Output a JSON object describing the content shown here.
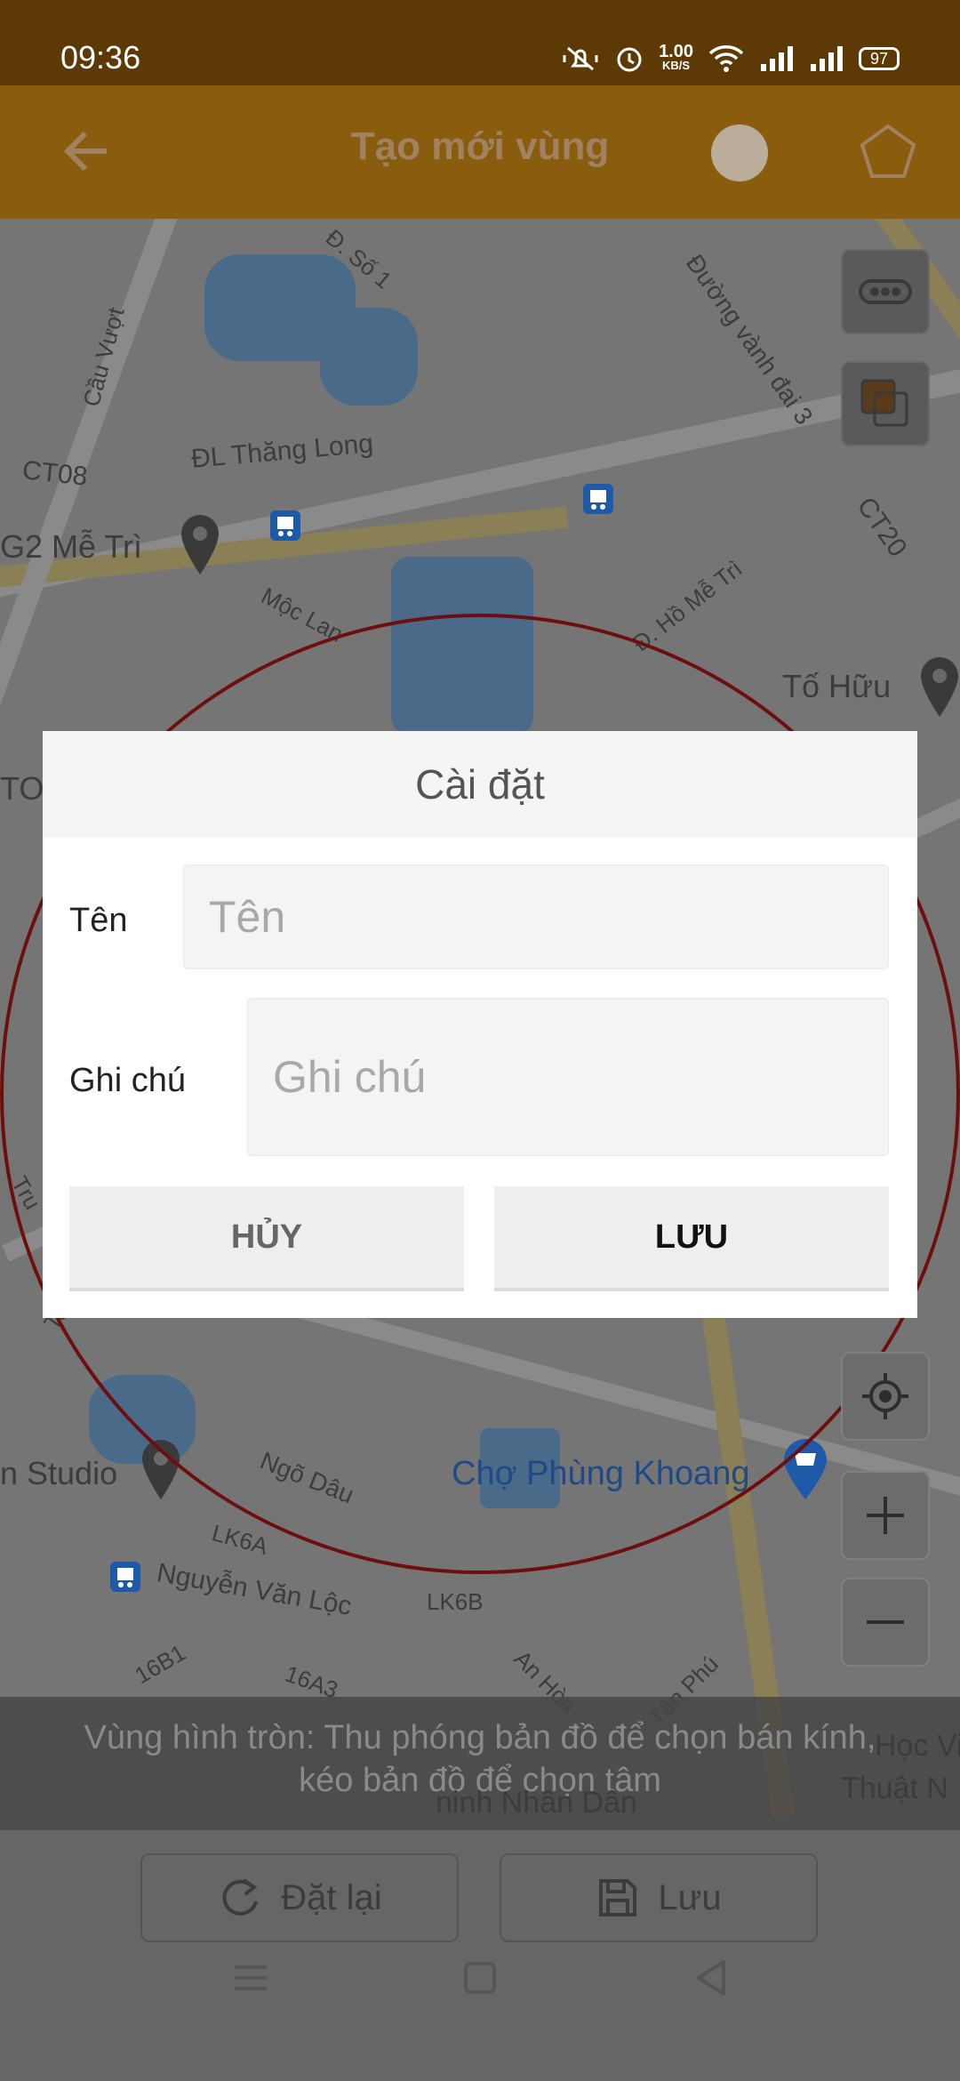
{
  "status_bar": {
    "time": "09:36",
    "net_speed_value": "1.00",
    "net_speed_unit": "KB/S",
    "battery": "97"
  },
  "app_bar": {
    "title": "Tạo mới vùng"
  },
  "map": {
    "labels": {
      "duong_so_1": "Đ. Số 1",
      "cau_vuot": "Cầu Vượt",
      "duong_vanh_dai_3": "Đường vành đai 3",
      "dl_thang_long": "ĐL Thăng Long",
      "ct08": "CT08",
      "ct20": "CT20",
      "g2_me_tri": "G2 Mễ Trì",
      "moc_lan": "Mộc Lan",
      "ho_me_tri": "Đ. Hồ Mễ Trì",
      "to_huu": "Tố Hữu",
      "tow": "TOV",
      "studio": "n Studio",
      "ngo_dau": "Ngõ Dâu",
      "cho_phung_khoang": "Chợ Phùng Khoang",
      "lk6a": "LK6A",
      "lk6b": "LK6B",
      "nguyen_van_loc": "Nguyễn Văn Lộc",
      "b16b1": "16B1",
      "a16a3": "16A3",
      "an_hoa": "An Hòa",
      "tan_phu": "Tân Phú",
      "hoc_vi": "Học Vi",
      "thuat_n": "Thuật N",
      "ninh_nhan_dan": "ninh Nhân Dân",
      "to": "To",
      "tru": "Tru"
    },
    "colors": {
      "radius_circle": "#6e0f0f",
      "poi_blue": "#1e5aa8"
    }
  },
  "hint": {
    "line1": "Vùng hình tròn: Thu phóng bản đồ để chọn bán kính,",
    "line2": "kéo bản đồ để chọn tâm"
  },
  "bottom_bar": {
    "reset_label": "Đặt lại",
    "save_label": "Lưu"
  },
  "dialog": {
    "title": "Cài đặt",
    "name_label": "Tên",
    "name_placeholder": "Tên",
    "note_label": "Ghi chú",
    "note_placeholder": "Ghi chú",
    "cancel_label": "HỦY",
    "save_label": "LƯU"
  },
  "icons": [
    "back-arrow-icon",
    "circle-shape-icon",
    "polygon-shape-icon",
    "map-type-icon",
    "layers-icon",
    "my-location-icon",
    "zoom-in-icon",
    "zoom-out-icon",
    "refresh-icon",
    "save-icon",
    "menu-nav-icon",
    "home-nav-icon",
    "back-nav-icon"
  ]
}
